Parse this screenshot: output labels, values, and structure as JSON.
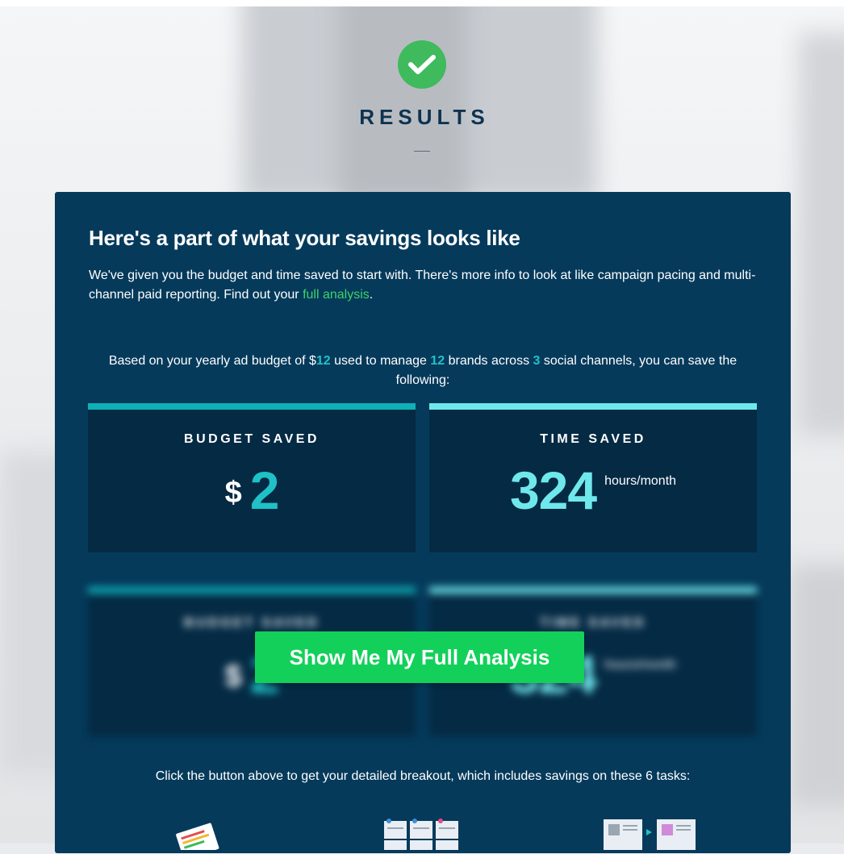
{
  "header": {
    "title": "RESULTS"
  },
  "card": {
    "heading": "Here's a part of what your savings looks like",
    "intro_text": "We've given you the budget and time saved to start with. There's more info to look at like campaign pacing and multi-channel paid reporting. Find out your ",
    "intro_link": "full analysis",
    "intro_end": ".",
    "basis": {
      "p1": "Based on your yearly ad budget of $",
      "budget": "12",
      "p2": " used to manage ",
      "brands": "12",
      "p3": " brands across ",
      "channels": "3",
      "p4": " social channels, you can save the following:"
    },
    "budget_stat": {
      "label": "BUDGET SAVED",
      "currency": "$",
      "value": "2"
    },
    "time_stat": {
      "label": "TIME SAVED",
      "value": "324",
      "unit": "hours/month"
    },
    "cta_label": "Show Me My Full Analysis",
    "tasks_note": "Click the button above to get your detailed breakout, which includes savings on these 6 tasks:",
    "task_icons": [
      "report-card-icon",
      "calendar-grid-icon",
      "content-workflow-icon"
    ]
  },
  "colors": {
    "card_bg": "#053a5b",
    "stat_bg": "#042a44",
    "accent_teal": "#22c0c6",
    "accent_cyan": "#6fe8ec",
    "link_green": "#3fd26a",
    "cta_green": "#13d05a",
    "check_green": "#3fba5d",
    "title_navy": "#0e3350"
  }
}
